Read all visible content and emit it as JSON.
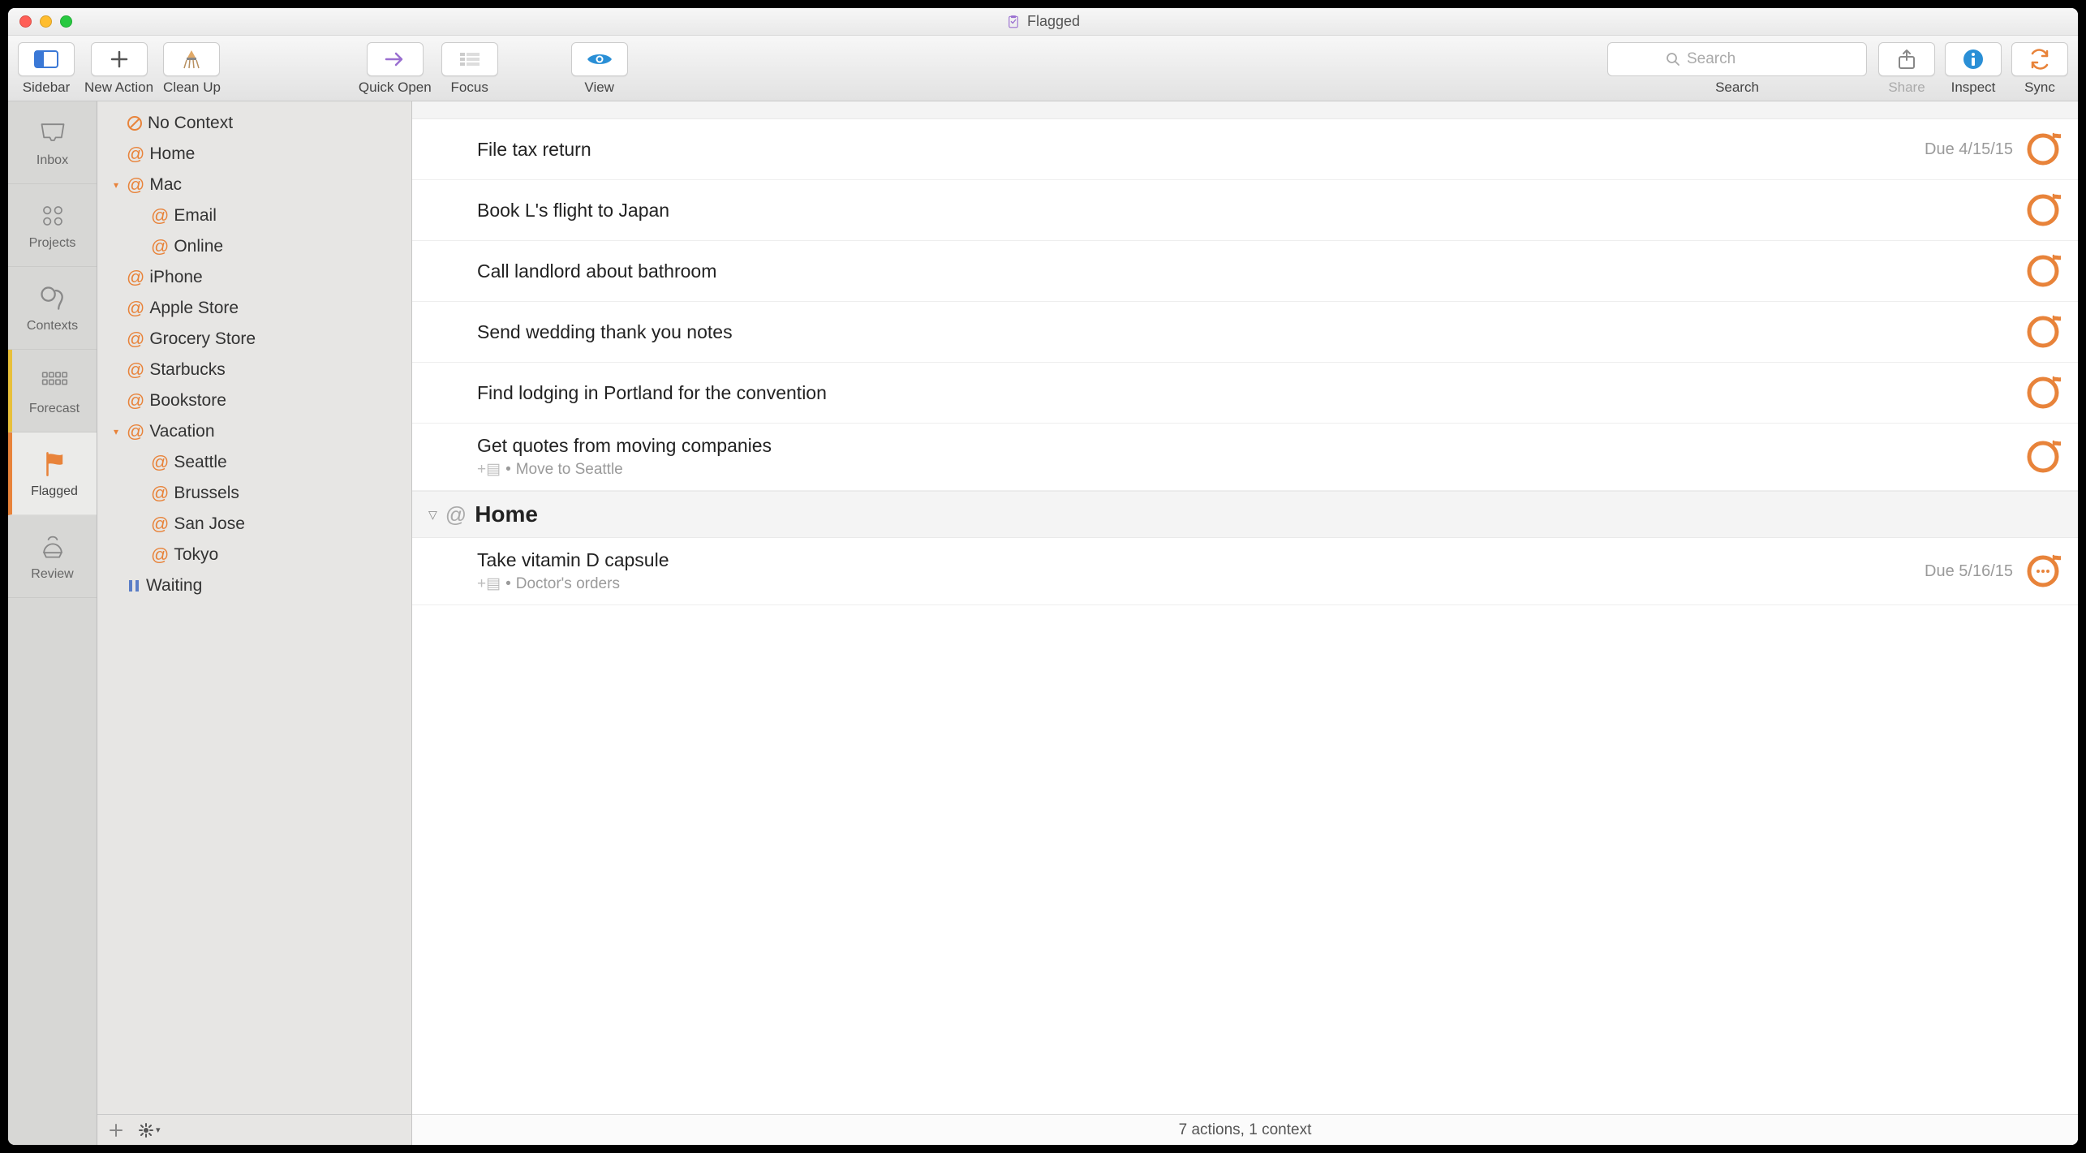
{
  "window": {
    "title": "Flagged"
  },
  "toolbar": {
    "sidebar": "Sidebar",
    "new_action": "New Action",
    "clean_up": "Clean Up",
    "quick_open": "Quick Open",
    "focus": "Focus",
    "view": "View",
    "search_label": "Search",
    "search_placeholder": "Search",
    "share": "Share",
    "inspect": "Inspect",
    "sync": "Sync"
  },
  "rail": {
    "items": [
      {
        "id": "inbox",
        "label": "Inbox"
      },
      {
        "id": "projects",
        "label": "Projects"
      },
      {
        "id": "contexts",
        "label": "Contexts"
      },
      {
        "id": "forecast",
        "label": "Forecast"
      },
      {
        "id": "flagged",
        "label": "Flagged"
      },
      {
        "id": "review",
        "label": "Review"
      }
    ],
    "selected": "flagged"
  },
  "contexts": {
    "tree": [
      {
        "label": "No Context",
        "kind": "nocontext",
        "depth": 0
      },
      {
        "label": "Home",
        "kind": "context",
        "depth": 0
      },
      {
        "label": "Mac",
        "kind": "context",
        "depth": 0,
        "expanded": true
      },
      {
        "label": "Email",
        "kind": "context",
        "depth": 1
      },
      {
        "label": "Online",
        "kind": "context",
        "depth": 1
      },
      {
        "label": "iPhone",
        "kind": "context",
        "depth": 0
      },
      {
        "label": "Apple Store",
        "kind": "context",
        "depth": 0
      },
      {
        "label": "Grocery Store",
        "kind": "context",
        "depth": 0
      },
      {
        "label": "Starbucks",
        "kind": "context",
        "depth": 0
      },
      {
        "label": "Bookstore",
        "kind": "context",
        "depth": 0
      },
      {
        "label": "Vacation",
        "kind": "context",
        "depth": 0,
        "expanded": true
      },
      {
        "label": "Seattle",
        "kind": "context",
        "depth": 1
      },
      {
        "label": "Brussels",
        "kind": "context",
        "depth": 1
      },
      {
        "label": "San Jose",
        "kind": "context",
        "depth": 1
      },
      {
        "label": "Tokyo",
        "kind": "context",
        "depth": 1
      },
      {
        "label": "Waiting",
        "kind": "waiting",
        "depth": 0
      }
    ]
  },
  "tasks": {
    "section1": [
      {
        "title": "File tax return",
        "due": "Due 4/15/15"
      },
      {
        "title": "Book L's flight to Japan"
      },
      {
        "title": "Call landlord about bathroom"
      },
      {
        "title": "Send wedding thank you notes"
      },
      {
        "title": "Find lodging in Portland for the convention"
      },
      {
        "title": "Get quotes from moving companies",
        "note": "Move to Seattle"
      }
    ],
    "section2_name": "Home",
    "section2": [
      {
        "title": "Take vitamin D capsule",
        "note": "Doctor's orders",
        "due": "Due 5/16/15",
        "repeating": true
      }
    ]
  },
  "status": "7 actions, 1 context"
}
